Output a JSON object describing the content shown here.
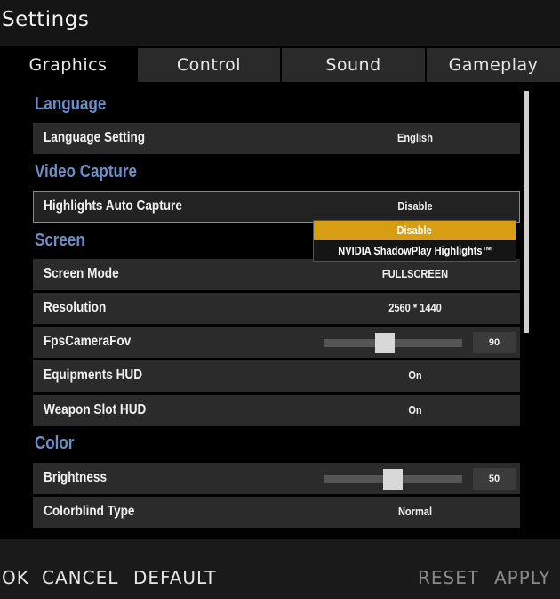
{
  "window": {
    "title": "Settings"
  },
  "tabs": [
    {
      "label": "Graphics",
      "active": true
    },
    {
      "label": "Control",
      "active": false
    },
    {
      "label": "Sound",
      "active": false
    },
    {
      "label": "Gameplay",
      "active": false
    }
  ],
  "sections": {
    "language": "Language",
    "video_capture": "Video Capture",
    "screen": "Screen",
    "color": "Color"
  },
  "rows": {
    "language_setting": {
      "label": "Language Setting",
      "value": "English"
    },
    "highlights_auto_capture": {
      "label": "Highlights Auto Capture",
      "value": "Disable"
    },
    "screen_mode": {
      "label": "Screen Mode",
      "value": "FULLSCREEN"
    },
    "resolution": {
      "label": "Resolution",
      "value": "2560 * 1440"
    },
    "fps_camera_fov": {
      "label": "FpsCameraFov",
      "value": "90",
      "slider_fraction": 0.43
    },
    "equipments_hud": {
      "label": "Equipments HUD",
      "value": "On"
    },
    "weapon_slot_hud": {
      "label": "Weapon Slot HUD",
      "value": "On"
    },
    "brightness": {
      "label": "Brightness",
      "value": "50",
      "slider_fraction": 0.5
    },
    "colorblind_type": {
      "label": "Colorblind Type",
      "value": "Normal"
    }
  },
  "dropdown": {
    "options": [
      "Disable",
      "NVIDIA ShadowPlay Highlights™"
    ],
    "selected": "Disable",
    "highlight_color": "#d89e13"
  },
  "footer": {
    "ok": "OK",
    "cancel": "CANCEL",
    "default": "DEFAULT",
    "reset": "RESET",
    "apply": "APPLY"
  },
  "colors": {
    "section_header": "#6d8fc7",
    "accent": "#d89e13"
  }
}
